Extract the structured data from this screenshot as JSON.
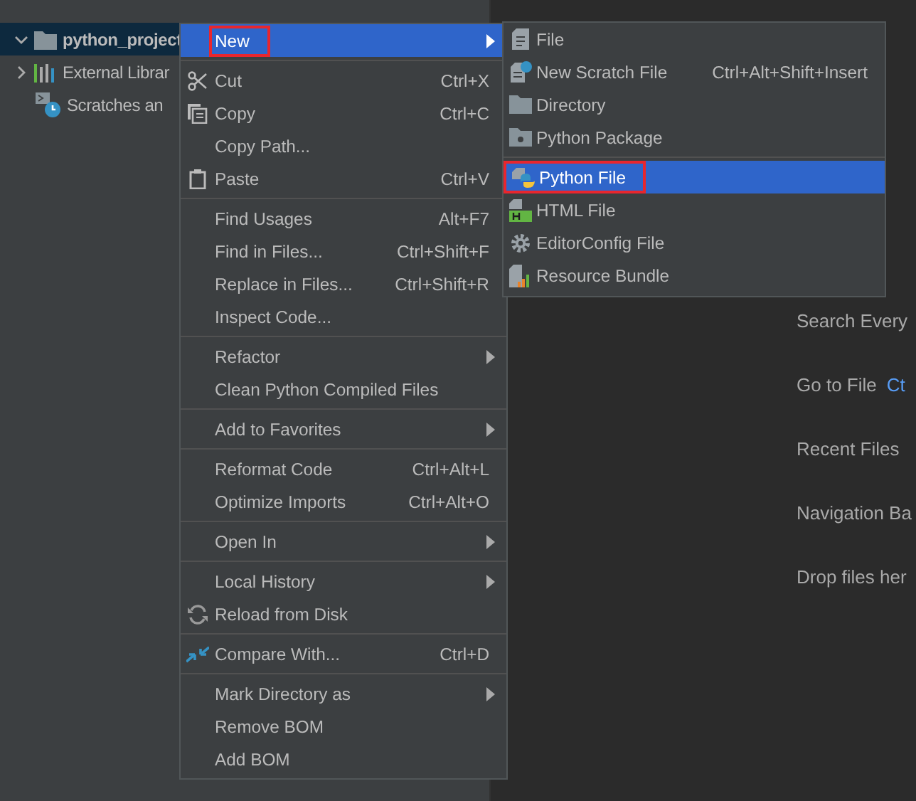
{
  "project_tree": [
    {
      "label": "python_project",
      "kind": "folder",
      "expanded": true,
      "selected": true
    },
    {
      "label": "External Librar",
      "kind": "library",
      "expanded": false,
      "selected": false
    },
    {
      "label": "Scratches an",
      "kind": "scratch",
      "selected": false
    }
  ],
  "editor_hints": [
    {
      "label": "Search Every"
    },
    {
      "label": "Go to File",
      "shortcut": "Ct"
    },
    {
      "label": "Recent Files"
    },
    {
      "label": "Navigation Ba"
    },
    {
      "label": "Drop files her"
    }
  ],
  "context_menu": {
    "groups": [
      [
        {
          "label": "New",
          "submenu": true,
          "selected": true,
          "outlined": true
        }
      ],
      [
        {
          "label": "Cut",
          "shortcut": "Ctrl+X",
          "kind": "scissors",
          "selected": false
        },
        {
          "label": "Copy",
          "shortcut": "Ctrl+C",
          "kind": "copy",
          "selected": false
        },
        {
          "label": "Copy Path...",
          "selected": false
        },
        {
          "label": "Paste",
          "shortcut": "Ctrl+V",
          "kind": "clipboard",
          "selected": false
        }
      ],
      [
        {
          "label": "Find Usages",
          "shortcut": "Alt+F7",
          "selected": false
        },
        {
          "label": "Find in Files...",
          "shortcut": "Ctrl+Shift+F",
          "selected": false
        },
        {
          "label": "Replace in Files...",
          "shortcut": "Ctrl+Shift+R",
          "selected": false
        },
        {
          "label": "Inspect Code...",
          "selected": false
        }
      ],
      [
        {
          "label": "Refactor",
          "submenu": true,
          "selected": false
        },
        {
          "label": "Clean Python Compiled Files",
          "selected": false
        }
      ],
      [
        {
          "label": "Add to Favorites",
          "submenu": true,
          "selected": false
        }
      ],
      [
        {
          "label": "Reformat Code",
          "shortcut": "Ctrl+Alt+L",
          "selected": false
        },
        {
          "label": "Optimize Imports",
          "shortcut": "Ctrl+Alt+O",
          "selected": false
        }
      ],
      [
        {
          "label": "Open In",
          "submenu": true,
          "selected": false
        }
      ],
      [
        {
          "label": "Local History",
          "submenu": true,
          "selected": false
        },
        {
          "label": "Reload from Disk",
          "kind": "reload",
          "selected": false
        }
      ],
      [
        {
          "label": "Compare With...",
          "shortcut": "Ctrl+D",
          "kind": "compare",
          "selected": false
        }
      ],
      [
        {
          "label": "Mark Directory as",
          "submenu": true,
          "selected": false
        },
        {
          "label": "Remove BOM",
          "selected": false
        },
        {
          "label": "Add BOM",
          "selected": false
        }
      ]
    ]
  },
  "new_submenu": {
    "groups": [
      [
        {
          "label": "File",
          "kind": "file",
          "selected": false
        },
        {
          "label": "New Scratch File",
          "shortcut": "Ctrl+Alt+Shift+Insert",
          "kind": "scratch",
          "selected": false
        },
        {
          "label": "Directory",
          "kind": "folder",
          "selected": false
        },
        {
          "label": "Python Package",
          "kind": "package",
          "selected": false
        }
      ],
      [
        {
          "label": "Python File",
          "kind": "python",
          "selected": true,
          "outlined": true
        },
        {
          "label": "HTML File",
          "kind": "html",
          "selected": false
        },
        {
          "label": "EditorConfig File",
          "kind": "gear",
          "selected": false
        },
        {
          "label": "Resource Bundle",
          "kind": "bundle",
          "selected": false
        }
      ]
    ]
  }
}
